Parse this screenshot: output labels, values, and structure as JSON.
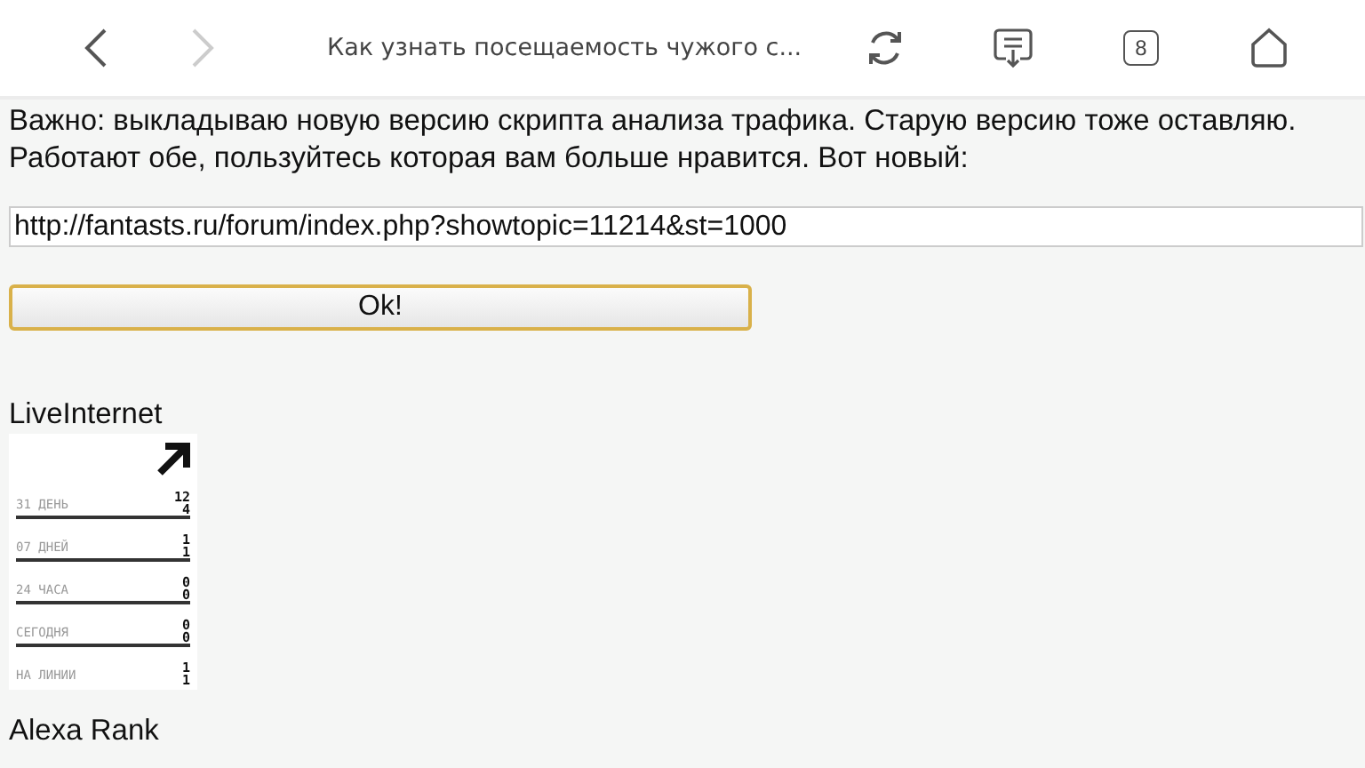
{
  "toolbar": {
    "title": "Как узнать посещаемость чужого с...",
    "tab_count": "8",
    "forward_disabled": true
  },
  "intro": "Важно: выкладываю новую версию скрипта анализа трафика. Старую версию тоже оставляю. Работают обе, пользуйтесь которая вам больше нравится. Вот новый:",
  "url_field": {
    "value": "http://fantasts.ru/forum/index.php?showtopic=11214&st=1000"
  },
  "ok_button": "Ok!",
  "counter": {
    "heading": "LiveInternet",
    "rows": [
      {
        "label": "31 ДЕНЬ",
        "values": [
          "12",
          "4"
        ]
      },
      {
        "label": "07 ДНЕЙ",
        "values": [
          "1",
          "1"
        ]
      },
      {
        "label": "24 ЧАСА",
        "values": [
          "0",
          "0"
        ]
      },
      {
        "label": "СЕГОДНЯ",
        "values": [
          "0",
          "0"
        ]
      },
      {
        "label": "НА ЛИНИИ",
        "values": [
          "1",
          "1"
        ]
      }
    ]
  },
  "alexa_heading": "Alexa Rank"
}
